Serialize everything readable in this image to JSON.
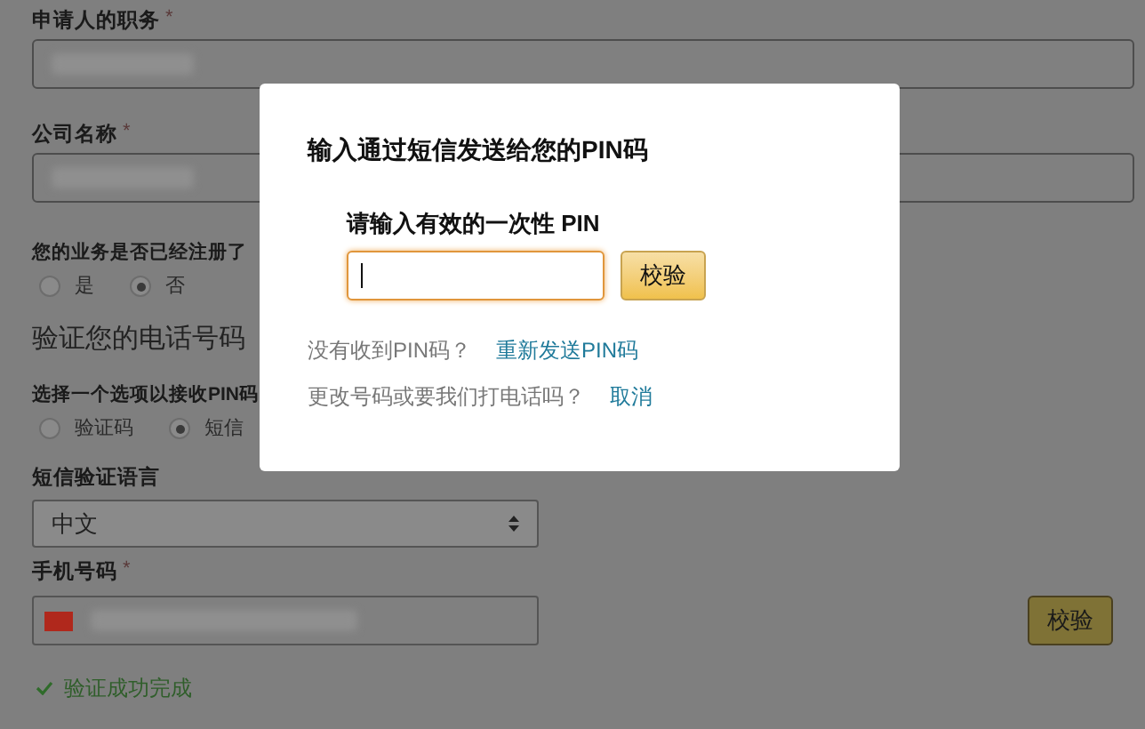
{
  "form": {
    "items": [
      {
        "kind": "field",
        "label": "申请人的职务",
        "required_mark": "*"
      },
      {
        "kind": "field",
        "label": "公司名称",
        "required_mark": "*"
      },
      {
        "kind": "radio",
        "label": "您的业务是否已经注册了",
        "options": [
          {
            "label": "是",
            "selected": false
          },
          {
            "label": "否",
            "selected": true
          }
        ]
      },
      {
        "kind": "heading",
        "text": "验证您的电话号码"
      },
      {
        "kind": "radio",
        "label": "选择一个选项以接收PIN码",
        "options": [
          {
            "label": "验证码",
            "selected": false
          },
          {
            "label": "短信",
            "selected": true
          }
        ]
      },
      {
        "kind": "select",
        "label": "短信验证语言",
        "value": "中文"
      },
      {
        "kind": "phone",
        "label": "手机号码",
        "required_mark": "*",
        "button": "校验"
      },
      {
        "kind": "success",
        "text": "验证成功完成"
      }
    ]
  },
  "dialog": {
    "title": "输入通过短信发送给您的PIN码",
    "pin_label": "请输入有效的一次性 PIN",
    "verify_button": "校验",
    "resend_prompt": "没有收到PIN码？",
    "resend_link": "重新发送PIN码",
    "change_prompt": "更改号码或要我们打电话吗？",
    "cancel_link": "取消"
  }
}
